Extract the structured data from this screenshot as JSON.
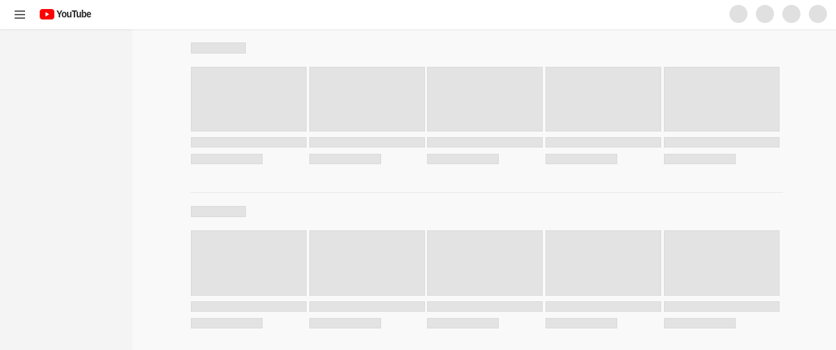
{
  "header": {
    "menu_icon": "hamburger-menu-icon",
    "logo_icon": "youtube-play-icon",
    "logo_text": "YouTube",
    "brand_color": "#ff0000"
  },
  "placeholder_color": "#e3e3e3",
  "shelves": [
    {
      "cards": 5
    },
    {
      "cards": 5
    }
  ]
}
